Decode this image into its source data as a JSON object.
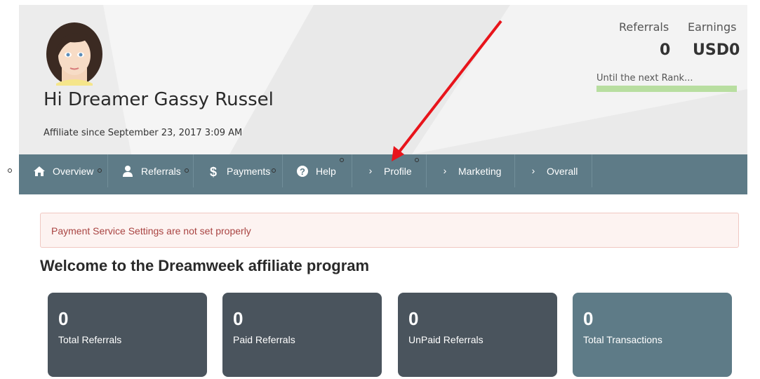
{
  "header": {
    "greeting": "Hi Dreamer Gassy Russel",
    "affiliate_since": "Affiliate since September 23, 2017 3:09 AM",
    "referrals_label": "Referrals",
    "referrals_value": "0",
    "earnings_label": "Earnings",
    "earnings_value": "USD0",
    "rank_label": "Until the next Rank...",
    "rank_progress": 1.0
  },
  "nav": {
    "items": [
      {
        "label": "Overview",
        "icon": "home-icon"
      },
      {
        "label": "Referrals",
        "icon": "user-icon"
      },
      {
        "label": "Payments",
        "icon": "dollar-icon"
      },
      {
        "label": "Help",
        "icon": "help-circle-icon"
      },
      {
        "label": "Profile",
        "icon": "chevron-right-icon"
      },
      {
        "label": "Marketing",
        "icon": "chevron-right-icon"
      },
      {
        "label": "Overall",
        "icon": "chevron-right-icon"
      }
    ]
  },
  "alert": {
    "message": "Payment Service Settings are not set properly"
  },
  "main": {
    "welcome": "Welcome to the Dreamweek affiliate program",
    "cards": [
      {
        "value": "0",
        "label": "Total Referrals",
        "color": "#4a545d"
      },
      {
        "value": "0",
        "label": "Paid Referrals",
        "color": "#4a545d"
      },
      {
        "value": "0",
        "label": "UnPaid Referrals",
        "color": "#4a545d"
      },
      {
        "value": "0",
        "label": "Total Transactions",
        "color": "#5e7b87"
      }
    ]
  },
  "colors": {
    "nav_bg": "#5e7b87",
    "alert_text": "#a94442",
    "annotation_arrow": "#e8141b"
  }
}
